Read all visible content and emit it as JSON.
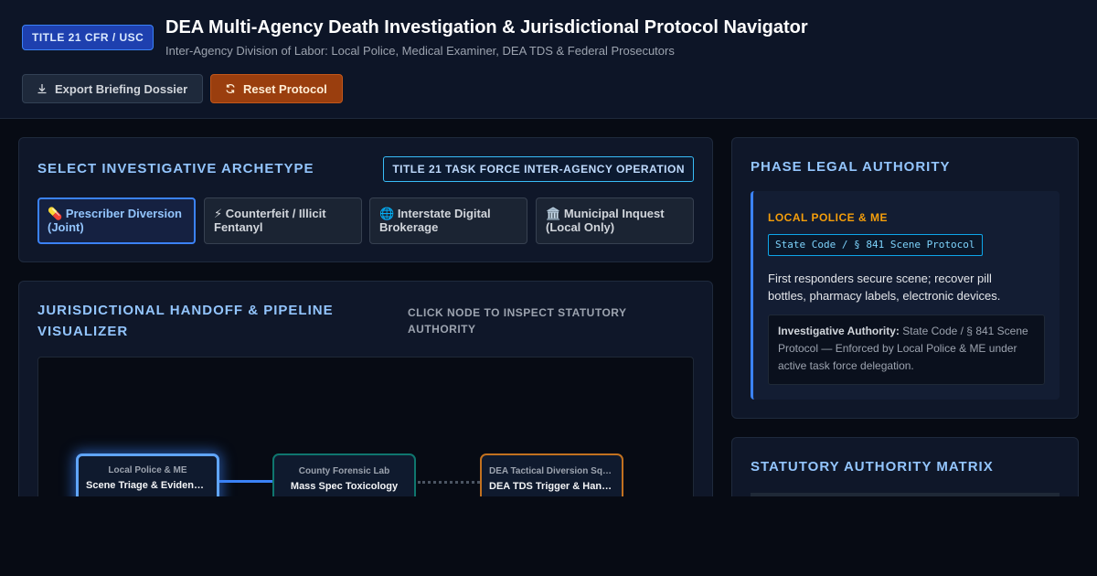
{
  "header": {
    "badge": "TITLE 21 CFR / USC",
    "title": "DEA Multi-Agency Death Investigation & Jurisdictional Protocol Navigator",
    "subtitle": "Inter-Agency Division of Labor: Local Police, Medical Examiner, DEA TDS & Federal Prosecutors",
    "export_label": "Export Briefing Dossier",
    "reset_label": "Reset Protocol"
  },
  "archetype": {
    "heading": "SELECT INVESTIGATIVE ARCHETYPE",
    "operation_badge": "TITLE 21 TASK FORCE INTER-AGENCY OPERATION",
    "options": [
      {
        "icon": "💊",
        "label": "Prescriber Diversion (Joint)"
      },
      {
        "icon": "⚡",
        "label": "Counterfeit / Illicit Fentanyl"
      },
      {
        "icon": "🌐",
        "label": "Interstate Digital Brokerage"
      },
      {
        "icon": "🏛️",
        "label": "Municipal Inquest (Local Only)"
      }
    ],
    "active_index": 0
  },
  "pipeline": {
    "heading": "JURISDICTIONAL HANDOFF & PIPELINE VISUALIZER",
    "hint": "CLICK NODE TO INSPECT STATUTORY AUTHORITY",
    "nodes": [
      {
        "agency": "Local Police & ME",
        "title": "Scene Triage & Evidence Recovery"
      },
      {
        "agency": "County Forensic Lab",
        "title": "Mass Spec Toxicology"
      },
      {
        "agency": "DEA Tactical Diversion Squad",
        "title": "DEA TDS Trigger & Handoff"
      }
    ]
  },
  "authority": {
    "heading": "PHASE LEGAL AUTHORITY",
    "agency": "LOCAL POLICE & ME",
    "code": "State Code / § 841 Scene Protocol",
    "description": "First responders secure scene; recover pill bottles, pharmacy labels, electronic devices.",
    "box_label": "Investigative Authority:",
    "box_text": "State Code / § 841 Scene Protocol — Enforced by Local Police & ME under active task force delegation."
  },
  "matrix": {
    "heading": "STATUTORY AUTHORITY MATRIX"
  },
  "colors": {
    "accent": "#3b82f6",
    "reset": "#9a3e0e",
    "agency_highlight": "#f59e0b"
  }
}
